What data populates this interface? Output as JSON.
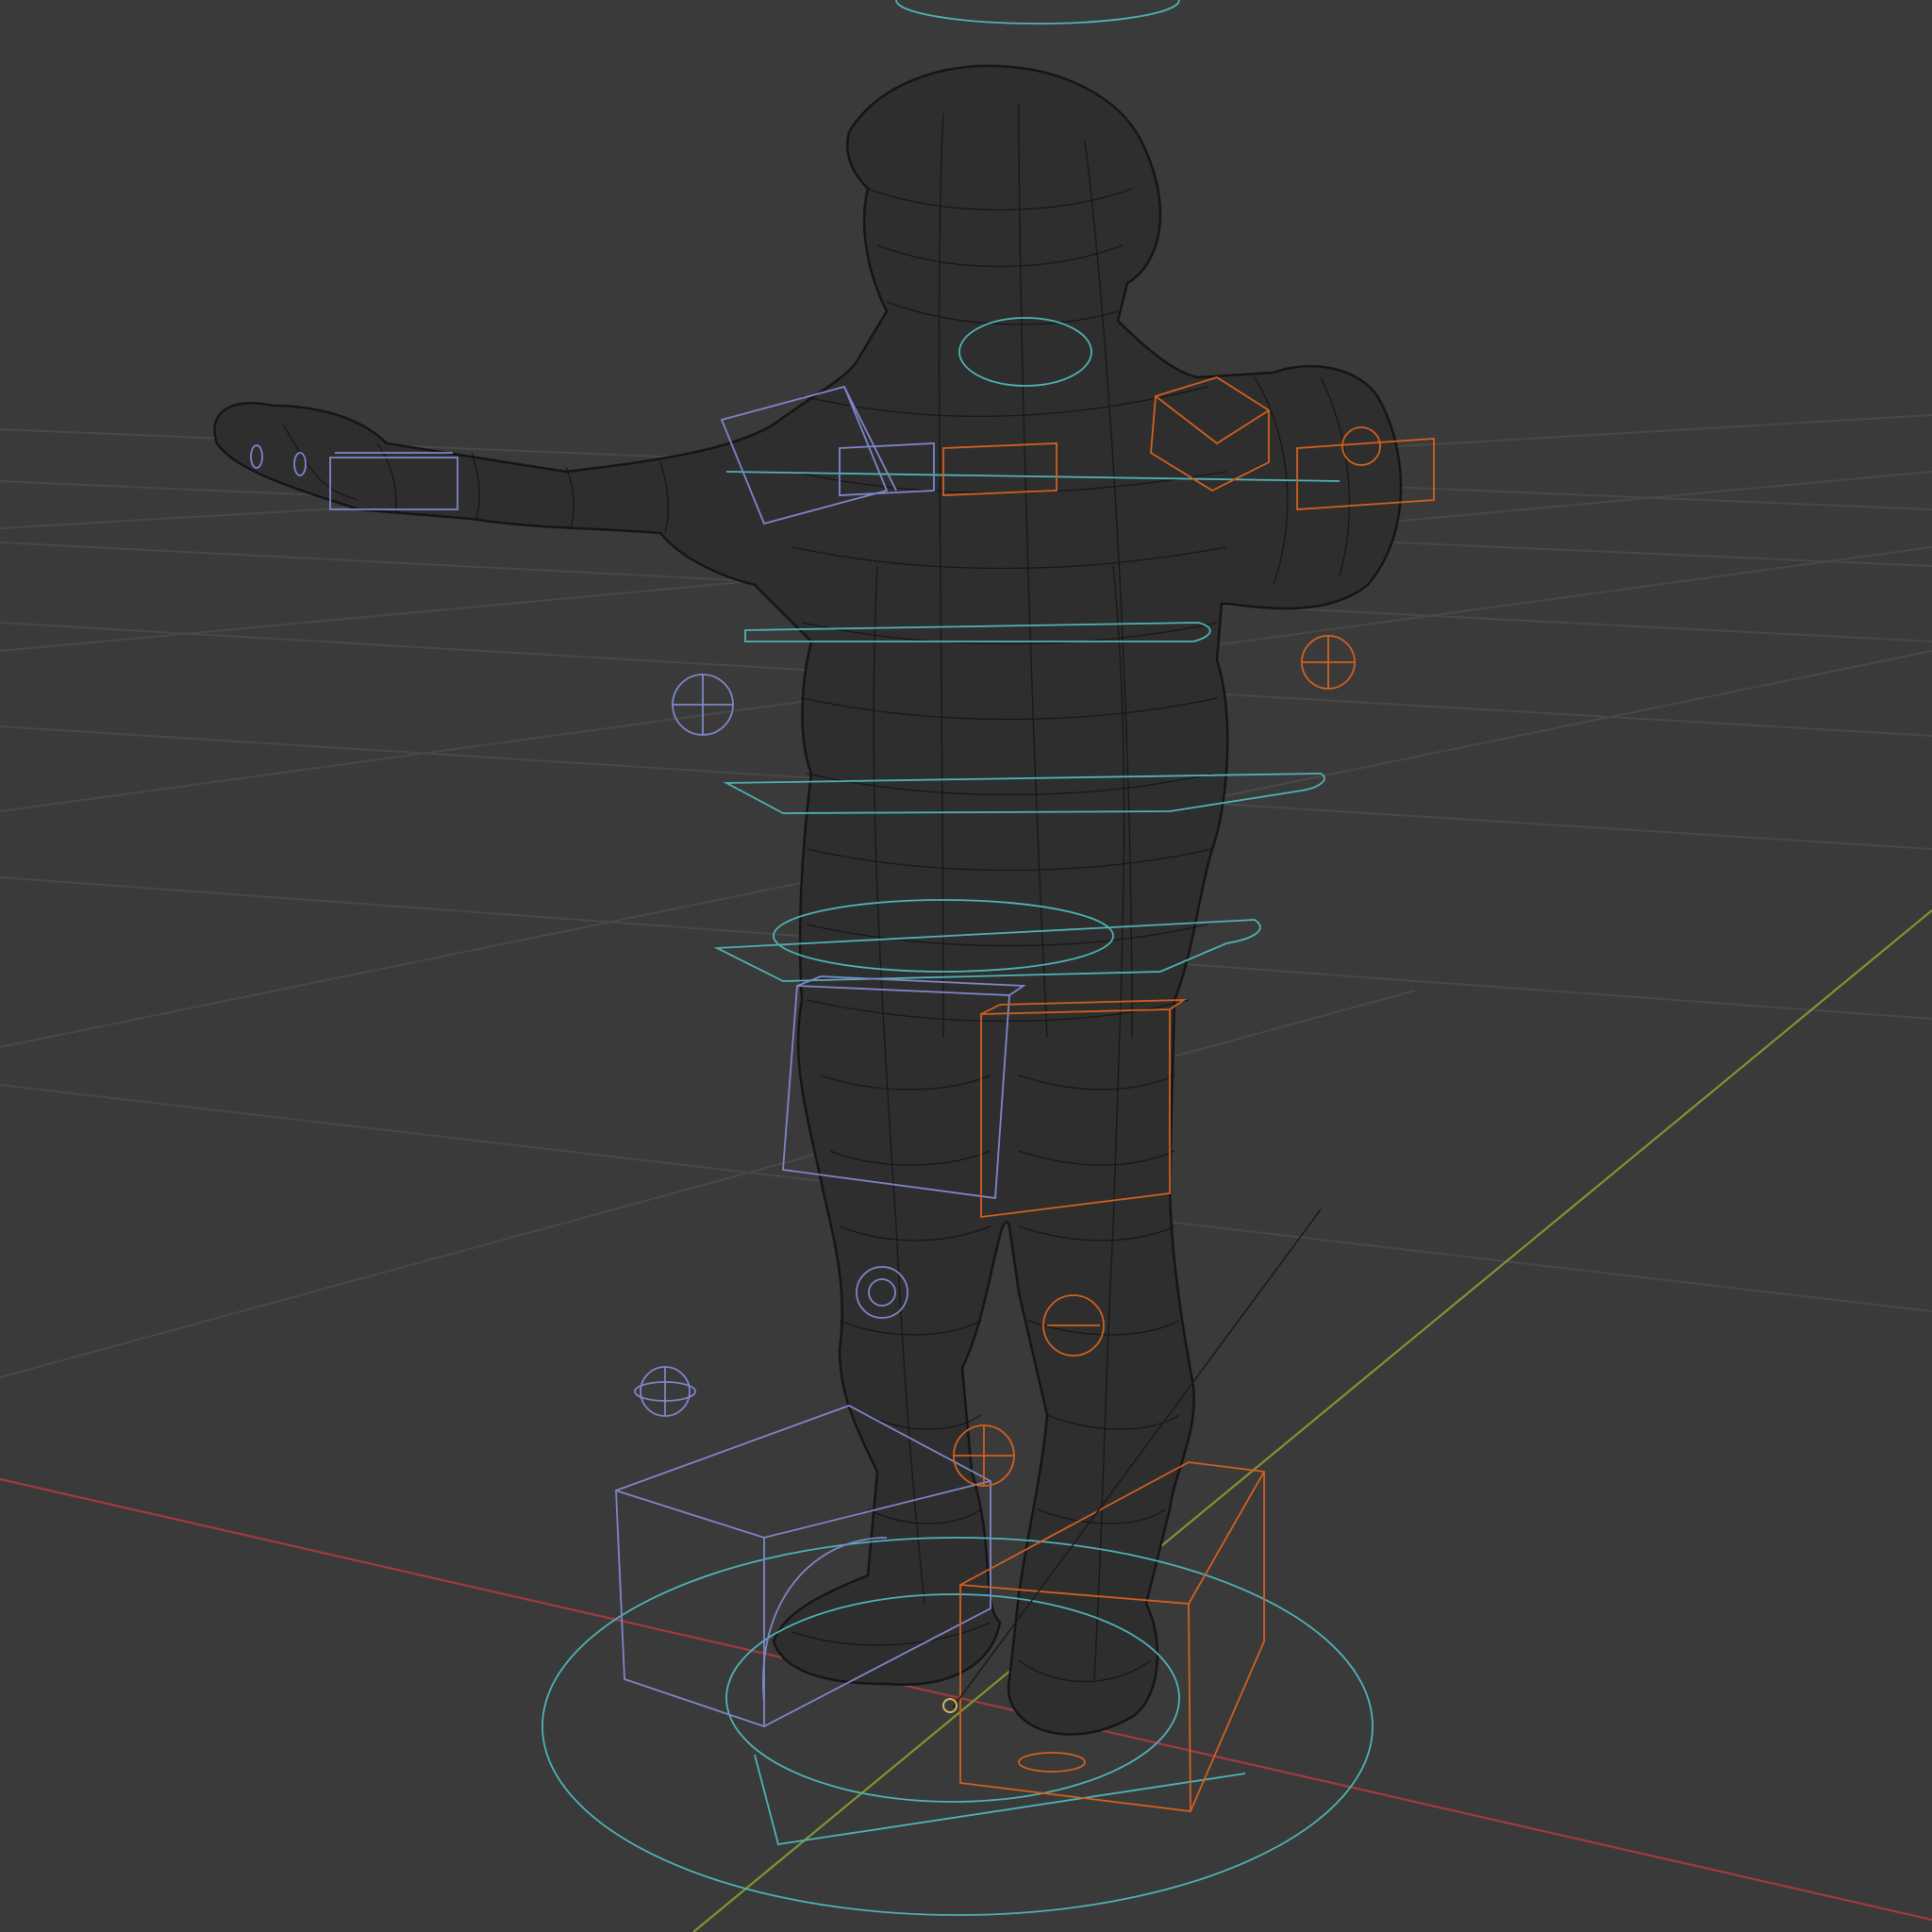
{
  "viewport": {
    "view_mode": "wireframe",
    "background_color": "#3a3a3a",
    "grid_color": "#484848",
    "axis_colors": {
      "x": "#a33a3f",
      "y": "#7f9630"
    }
  },
  "scene": {
    "object": "character-mesh",
    "mesh_wire_color": "#141414",
    "rig_colors": {
      "left_side": "#7f86c9",
      "right_side": "#d2601f",
      "center": "#4fb3b6"
    },
    "controls": [
      "root-circle-control",
      "hip-ring-control",
      "torso-ring-control",
      "chest-ring-control",
      "neck-ring-control",
      "head-top-ring-control",
      "shoulder-bar-control",
      "arm-l-ik-box",
      "arm-r-ik-box",
      "thigh-l-box",
      "thigh-r-box",
      "foot-l-box",
      "foot-r-box",
      "elbow-l-pole",
      "elbow-r-pole",
      "knee-l-pole",
      "knee-r-pole",
      "ankle-l-gizmo",
      "ankle-r-gizmo",
      "hand-l-box",
      "hand-r-box"
    ]
  }
}
